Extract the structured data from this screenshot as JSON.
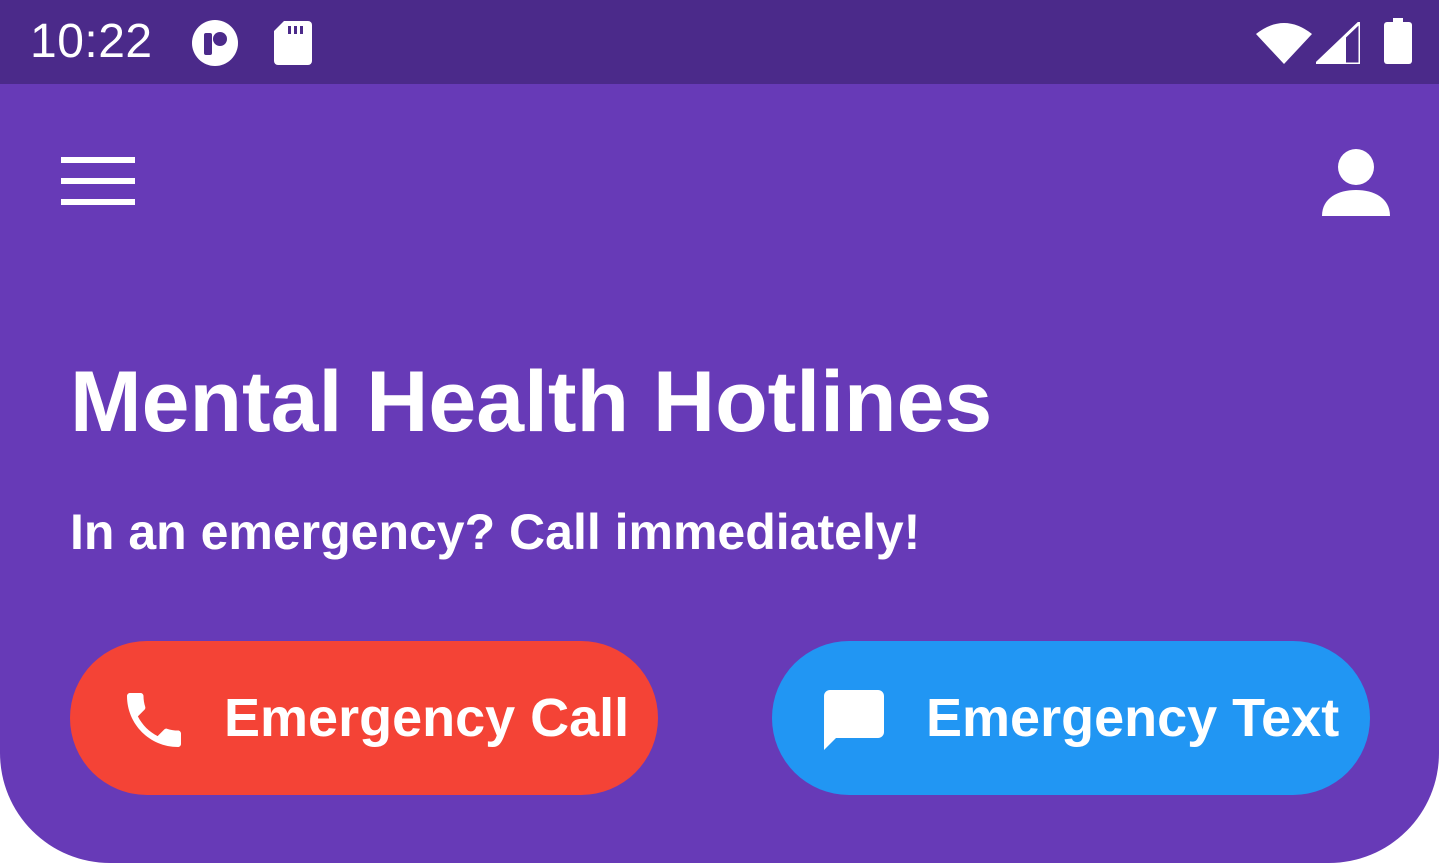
{
  "status_bar": {
    "time": "10:22",
    "icons": [
      "app-notification-icon",
      "sd-card-icon",
      "wifi-icon",
      "cell-signal-icon",
      "battery-icon"
    ],
    "background": "#4b2a8a"
  },
  "header": {
    "menu_icon": "hamburger-menu-icon",
    "profile_icon": "account-icon",
    "background": "#673ab7"
  },
  "hero": {
    "title": "Mental Health Hotlines",
    "subtitle": "In an emergency? Call immediately!"
  },
  "actions": {
    "call": {
      "label": "Emergency Call",
      "icon": "phone-icon",
      "color": "#f44336"
    },
    "text": {
      "label": "Emergency Text",
      "icon": "message-icon",
      "color": "#2196f3"
    }
  }
}
